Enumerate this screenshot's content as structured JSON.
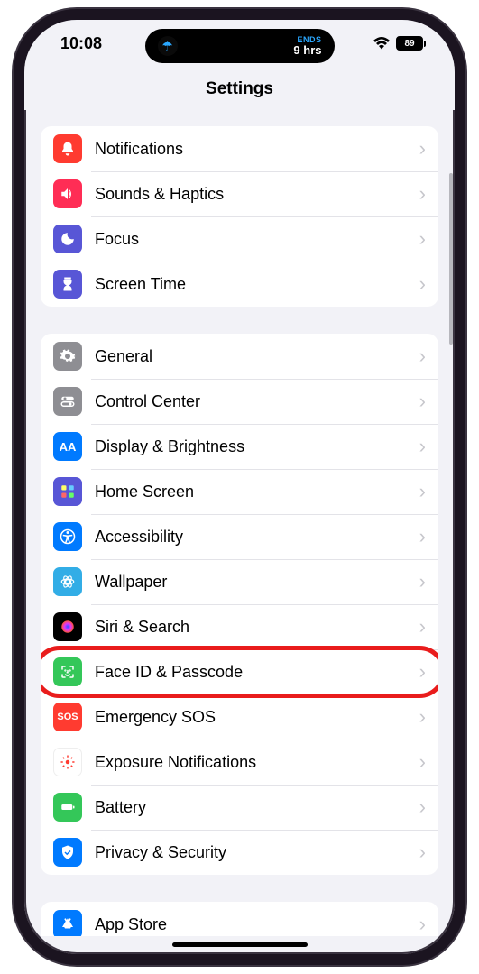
{
  "status": {
    "time": "10:08",
    "island_ends": "ENDS",
    "island_hrs": "9 hrs",
    "battery": "89"
  },
  "header": {
    "title": "Settings"
  },
  "groups": [
    {
      "rows": [
        {
          "label": "Notifications",
          "icon": "notifications-icon",
          "bg": "bg-red"
        },
        {
          "label": "Sounds & Haptics",
          "icon": "sounds-icon",
          "bg": "bg-pink"
        },
        {
          "label": "Focus",
          "icon": "focus-icon",
          "bg": "bg-purple"
        },
        {
          "label": "Screen Time",
          "icon": "screentime-icon",
          "bg": "bg-purple"
        }
      ]
    },
    {
      "rows": [
        {
          "label": "General",
          "icon": "general-icon",
          "bg": "bg-gray"
        },
        {
          "label": "Control Center",
          "icon": "controlcenter-icon",
          "bg": "bg-gray"
        },
        {
          "label": "Display & Brightness",
          "icon": "display-icon",
          "bg": "bg-blue"
        },
        {
          "label": "Home Screen",
          "icon": "homescreen-icon",
          "bg": "bg-purple"
        },
        {
          "label": "Accessibility",
          "icon": "accessibility-icon",
          "bg": "bg-blue"
        },
        {
          "label": "Wallpaper",
          "icon": "wallpaper-icon",
          "bg": "bg-cyan"
        },
        {
          "label": "Siri & Search",
          "icon": "siri-icon",
          "bg": "bg-black"
        },
        {
          "label": "Face ID & Passcode",
          "icon": "faceid-icon",
          "bg": "bg-green",
          "highlighted": true
        },
        {
          "label": "Emergency SOS",
          "icon": "sos-icon",
          "bg": "bg-sos"
        },
        {
          "label": "Exposure Notifications",
          "icon": "exposure-icon",
          "bg": "bg-white"
        },
        {
          "label": "Battery",
          "icon": "battery-icon",
          "bg": "bg-green"
        },
        {
          "label": "Privacy & Security",
          "icon": "privacy-icon",
          "bg": "bg-blue"
        }
      ]
    },
    {
      "rows": [
        {
          "label": "App Store",
          "icon": "appstore-icon",
          "bg": "bg-blue"
        }
      ]
    }
  ]
}
